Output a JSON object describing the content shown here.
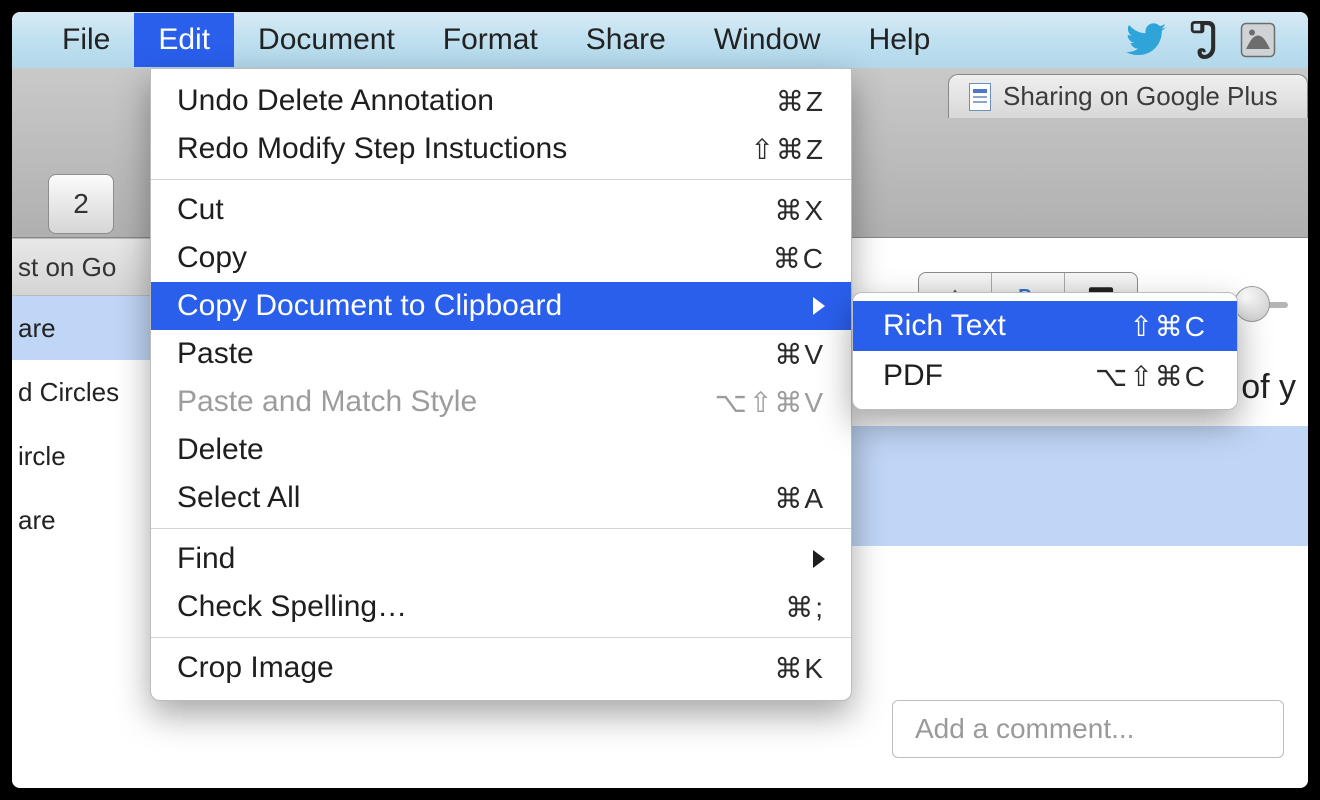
{
  "menubar": {
    "items": [
      "File",
      "Edit",
      "Document",
      "Format",
      "Share",
      "Window",
      "Help"
    ],
    "open_index": 1
  },
  "tab": {
    "title": "Sharing on Google Plus"
  },
  "toolbar": {
    "button_label": "2"
  },
  "sidebar": {
    "header": "st on Go",
    "rows": [
      {
        "label": "are",
        "selected": true
      },
      {
        "label": "d Circles",
        "selected": false
      },
      {
        "label": "ircle",
        "selected": false
      },
      {
        "label": "are",
        "selected": false
      }
    ]
  },
  "content": {
    "heading_fragment": "of y",
    "comment_placeholder": "Add a comment..."
  },
  "edit_menu": {
    "items": [
      {
        "label": "Undo Delete Annotation",
        "shortcut": "⌘Z"
      },
      {
        "label": "Redo Modify Step Instuctions",
        "shortcut": "⇧⌘Z"
      },
      {
        "separator": true
      },
      {
        "label": "Cut",
        "shortcut": "⌘X"
      },
      {
        "label": "Copy",
        "shortcut": "⌘C"
      },
      {
        "label": "Copy Document to Clipboard",
        "submenu": true,
        "highlighted": true
      },
      {
        "label": "Paste",
        "shortcut": "⌘V"
      },
      {
        "label": "Paste and Match Style",
        "shortcut": "⌥⇧⌘V",
        "disabled": true
      },
      {
        "label": "Delete"
      },
      {
        "label": "Select All",
        "shortcut": "⌘A"
      },
      {
        "separator": true
      },
      {
        "label": "Find",
        "submenu": true
      },
      {
        "label": "Check Spelling…",
        "shortcut": "⌘;"
      },
      {
        "separator": true
      },
      {
        "label": "Crop Image",
        "shortcut": "⌘K"
      }
    ]
  },
  "submenu": {
    "items": [
      {
        "label": "Rich Text",
        "shortcut": "⇧⌘C",
        "highlighted": true
      },
      {
        "label": "PDF",
        "shortcut": "⌥⇧⌘C"
      }
    ]
  }
}
